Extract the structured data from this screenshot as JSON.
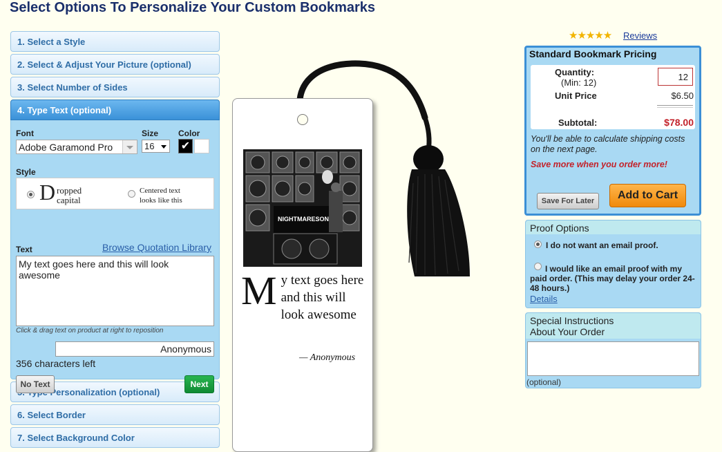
{
  "page": {
    "title": "Select Options To Personalize Your Custom Bookmarks"
  },
  "steps": [
    {
      "label": "1. Select a Style"
    },
    {
      "label": "2. Select & Adjust Your Picture (optional)"
    },
    {
      "label": "3. Select Number of Sides"
    },
    {
      "label": "4. Type Text (optional)"
    },
    {
      "label": "5. Type Personalization (optional)"
    },
    {
      "label": "6. Select Border"
    },
    {
      "label": "7. Select Background Color"
    }
  ],
  "text_panel": {
    "font_label": "Font",
    "font_value": "Adobe Garamond Pro",
    "size_label": "Size",
    "size_value": "16",
    "color_label": "Color",
    "color_check": "✔",
    "style_label": "Style",
    "style_dropped_letter": "D",
    "style_dropped_line1": "ropped",
    "style_dropped_line2": "capital",
    "style_centered_line1": "Centered text",
    "style_centered_line2": "looks like this",
    "text_label": "Text",
    "browse_link": "Browse Quotation Library",
    "text_value": "My text goes here and this will look awesome",
    "hint": "Click & drag text on product at right to reposition",
    "author_value": "Anonymous",
    "chars_left": "356 characters left",
    "no_text_button": "No Text",
    "next_button": "Next"
  },
  "preview": {
    "cap_letter": "M",
    "body_text": "y text goes here and this will look awesome",
    "author_line": "— Anonymous",
    "photo_caption": "NIGHTMARESONWAX"
  },
  "rating": {
    "stars": "★★★★★",
    "reviews_link": "Reviews",
    "value": 5
  },
  "pricing": {
    "title": "Standard Bookmark Pricing",
    "quantity_label": "Quantity:",
    "min_label": "(Min: 12)",
    "quantity_value": "12",
    "unit_price_label": "Unit Price",
    "unit_price_value": "$6.50",
    "subtotal_label": "Subtotal:",
    "subtotal_value": "$78.00",
    "shipping_note": "You'll be able to calculate shipping costs on the next page.",
    "save_more": "Save more when you order more!",
    "save_later_button": "Save For Later",
    "add_to_cart_button": "Add to Cart"
  },
  "proof": {
    "title": "Proof Options",
    "option_no": "I do not want an email proof.",
    "option_yes": "I would like an email proof with my paid order. (This may delay your order 24-48 hours.)",
    "details_link": "Details"
  },
  "special": {
    "title_line1": "Special Instructions",
    "title_line2": "About Your Order",
    "optional": "(optional)"
  },
  "colors": {
    "accent": "#3b8fd6",
    "next": "#118a33",
    "cart": "#f08a0c",
    "subtotal": "#c3222a"
  }
}
